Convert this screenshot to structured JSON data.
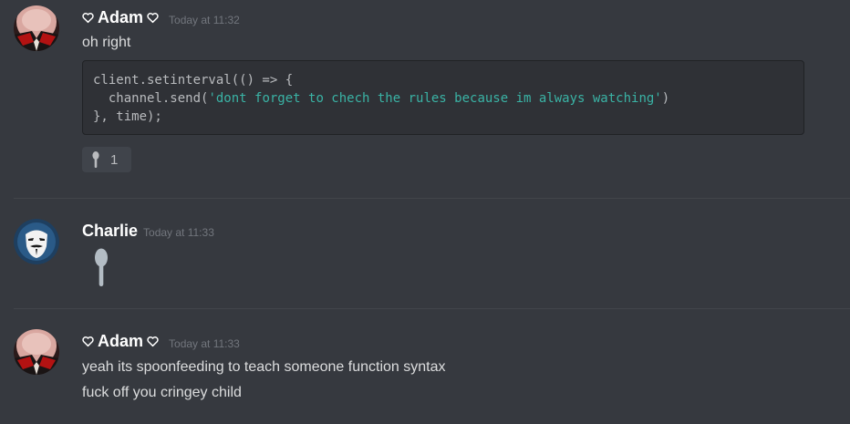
{
  "messages": [
    {
      "author": "Adam",
      "author_decoration": "heart-icon",
      "timestamp": "Today at 11:32",
      "text": "oh right",
      "code": {
        "line1": "client.setinterval(() => {",
        "line2_prefix": "  channel.send(",
        "line2_string": "'dont forget to chech the rules because im always watching'",
        "line2_suffix": ")",
        "line3": "}, time);"
      },
      "reaction": {
        "emoji": "spoon-icon",
        "count": "1"
      }
    },
    {
      "author": "Charlie",
      "timestamp": "Today at 11:33",
      "emoji": "spoon-icon"
    },
    {
      "author": "Adam",
      "author_decoration": "heart-icon",
      "timestamp": "Today at 11:33",
      "lines": [
        "yeah its spoonfeeding to teach someone function syntax",
        "fuck off you cringey child"
      ]
    }
  ],
  "colors": {
    "background": "#36393f",
    "code_background": "#2f3136",
    "code_string": "#3ab3a5",
    "timestamp": "#72767d",
    "reaction_background": "#40444b"
  }
}
